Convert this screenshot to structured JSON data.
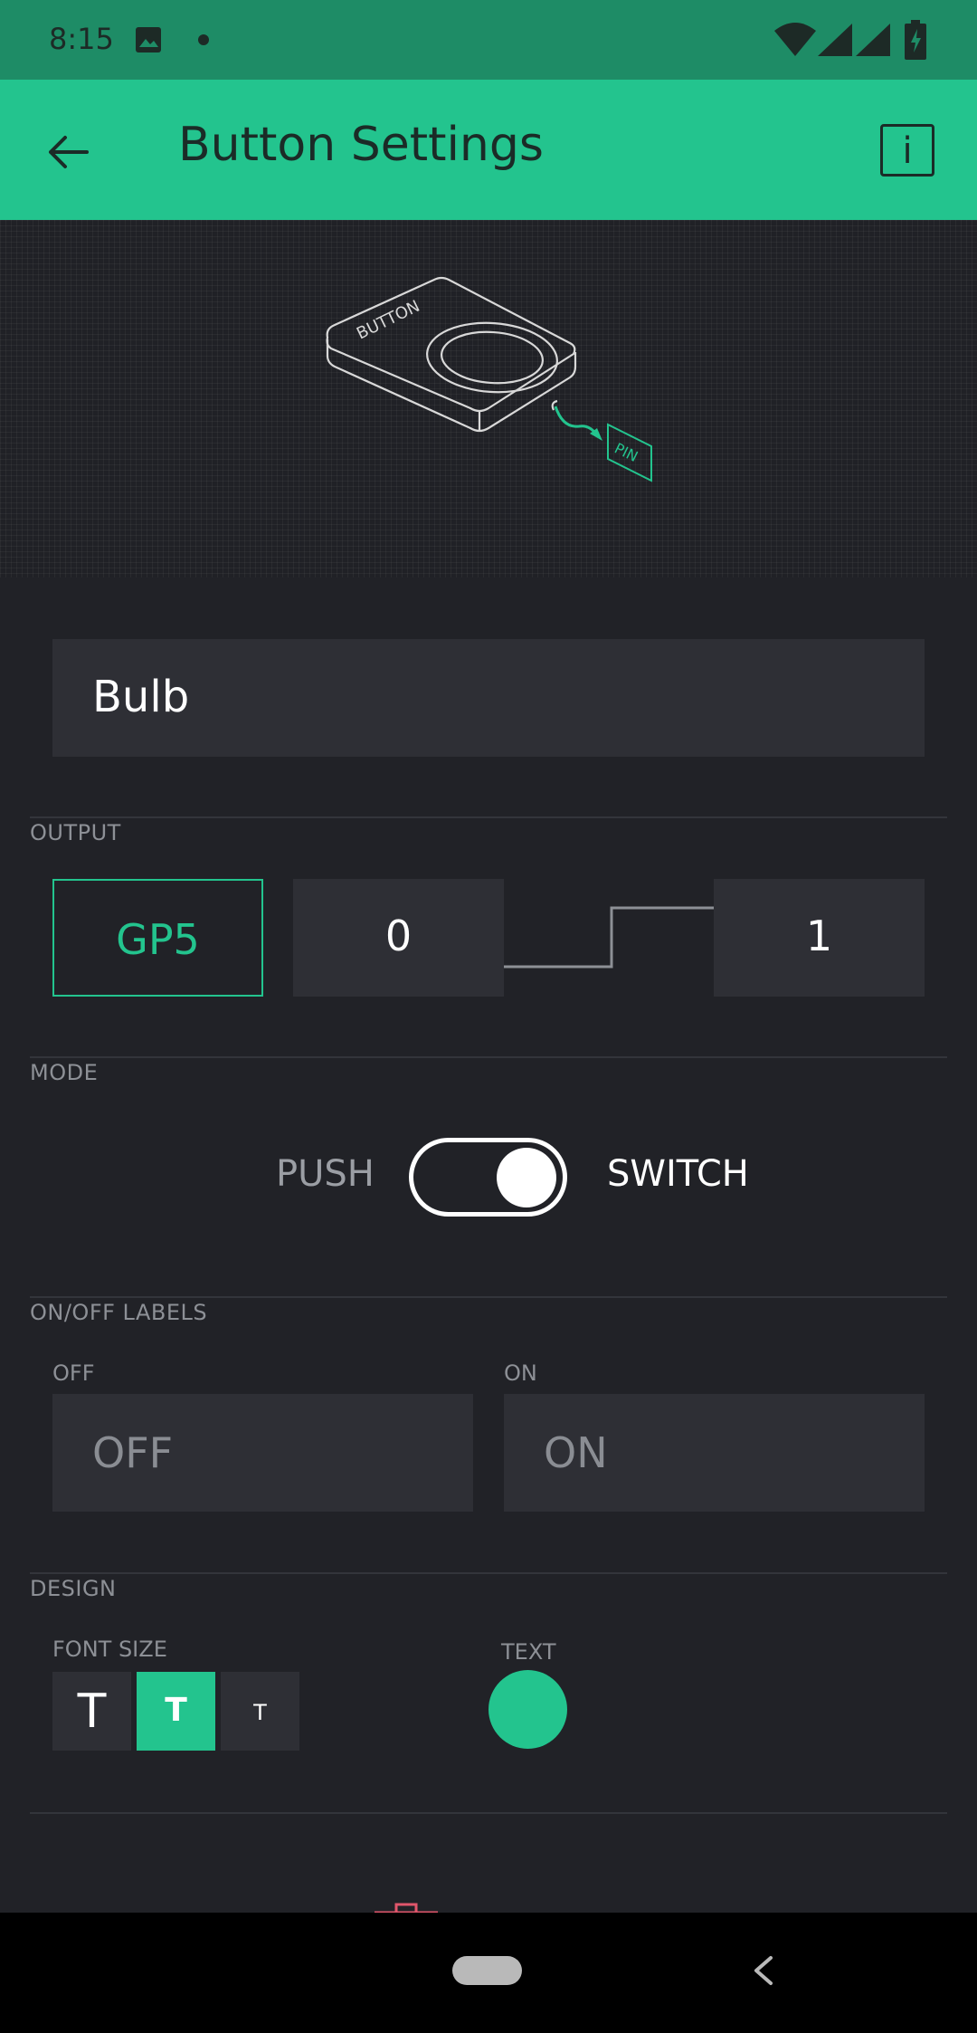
{
  "status_bar": {
    "time": "8:15",
    "icons": [
      "photo-icon",
      "dot-icon",
      "wifi-icon",
      "signal-icon",
      "signal-icon",
      "battery-charging-icon"
    ]
  },
  "app_bar": {
    "title": "Button Settings",
    "back_icon": "arrow-left-icon",
    "info_icon": "info-icon",
    "info_glyph": "i"
  },
  "illustration": {
    "button_text": "BUTTON",
    "pin_text": "PIN"
  },
  "name_field": {
    "value": "Bulb"
  },
  "output": {
    "section_label": "OUTPUT",
    "pin": "GP5",
    "low_value": "0",
    "high_value": "1"
  },
  "mode": {
    "section_label": "MODE",
    "left_label": "PUSH",
    "right_label": "SWITCH",
    "toggle_on": true
  },
  "on_off_labels": {
    "section_label": "ON/OFF LABELS",
    "off_label": "OFF",
    "off_value": "OFF",
    "on_label": "ON",
    "on_value": "ON"
  },
  "design": {
    "section_label": "DESIGN",
    "font_size_label": "FONT SIZE",
    "font_sizes": [
      "T",
      "T",
      "T"
    ],
    "selected_font_size_index": 1,
    "text_label": "TEXT",
    "text_color": "#23c48e"
  },
  "colors": {
    "accent": "#23c48e",
    "status_bar": "#1e8c66",
    "background": "#212227",
    "field": "#2e2f35"
  }
}
